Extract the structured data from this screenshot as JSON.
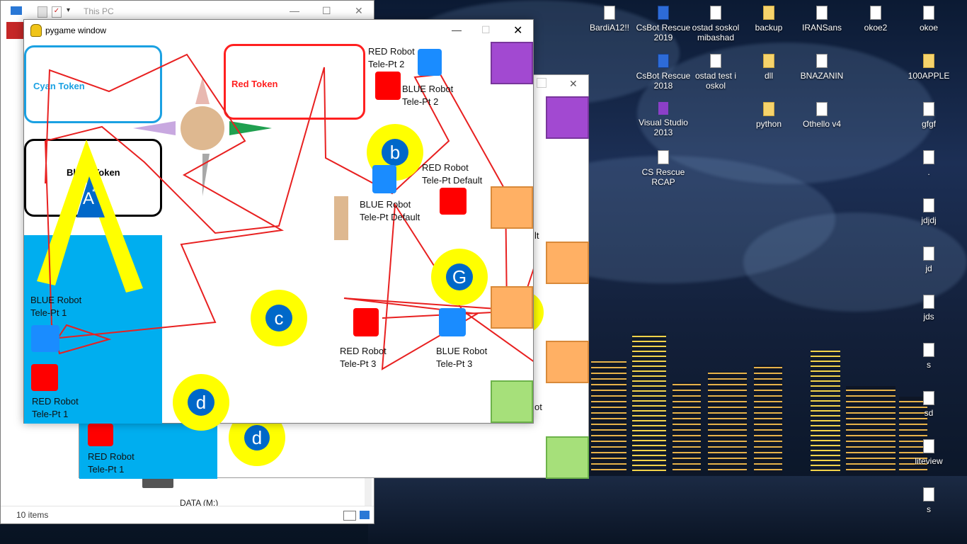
{
  "desktop": {
    "icons": [
      {
        "label": "BardiA12!!",
        "icon": "file-icon"
      },
      {
        "label": "CsBot Rescue 2019",
        "icon": "app-icon"
      },
      {
        "label": "ostad soskol mibashad",
        "icon": "file-icon"
      },
      {
        "label": "backup",
        "icon": "folder-icon"
      },
      {
        "label": "IRANSans",
        "icon": "font-file-icon"
      },
      {
        "label": "okoe2",
        "icon": "file-icon"
      },
      {
        "label": "okoe",
        "icon": "file-icon"
      },
      {
        "label": "CsBot Rescue 2018",
        "icon": "app-icon"
      },
      {
        "label": "ostad test i oskol",
        "icon": "file-icon"
      },
      {
        "label": "dll",
        "icon": "folder-icon"
      },
      {
        "label": "BNAZANIN",
        "icon": "font-file-icon"
      },
      {
        "label": "100APPLE",
        "icon": "folder-icon"
      },
      {
        "label": "Visual Studio 2013",
        "icon": "visual-studio-icon"
      },
      {
        "label": "python",
        "icon": "folder-icon"
      },
      {
        "label": "Othello v4",
        "icon": "file-icon"
      },
      {
        "label": "gfgf",
        "icon": "file-icon"
      },
      {
        "label": "CS Rescue RCAP",
        "icon": "file-icon"
      },
      {
        "label": ".",
        "icon": "file-icon"
      },
      {
        "label": "jdjdj",
        "icon": "file-icon"
      },
      {
        "label": "jd",
        "icon": "file-icon"
      },
      {
        "label": "jds",
        "icon": "file-icon"
      },
      {
        "label": "s",
        "icon": "file-icon"
      },
      {
        "label": "sd",
        "icon": "file-icon"
      },
      {
        "label": "liteview",
        "icon": "file-icon"
      },
      {
        "label": "s",
        "icon": "file-icon"
      }
    ]
  },
  "explorer": {
    "title": "This PC",
    "status": "10 items",
    "drive": "DATA (M:)",
    "min": "—",
    "max": "☐",
    "close": "✕"
  },
  "pygame": {
    "title": "pygame window",
    "min": "—",
    "max": "☐",
    "close": "✕",
    "tokens": {
      "cyan": "Cyan Token",
      "red": "Red Token",
      "black": "Black Token"
    },
    "a_star": "A",
    "a_star_mark": "*",
    "circles": {
      "b": "b",
      "c": "c",
      "g": "G",
      "d": "d"
    },
    "labels": {
      "red_tp2_l1": "RED Robot",
      "red_tp2_l2": "Tele-Pt 2",
      "blue_tp2_l1": "BLUE Robot",
      "blue_tp2_l2": "Tele-Pt 2",
      "red_tpd_l1": "RED Robot",
      "red_tpd_l2": "Tele-Pt Default",
      "blue_tpd_l1": "BLUE Robot",
      "blue_tpd_l2": "Tele-Pt Default",
      "blue_tp1_l1": "BLUE Robot",
      "blue_tp1_l2": "Tele-Pt 1",
      "red_tp1_l1": "RED Robot",
      "red_tp1_l2": "Tele-Pt 1",
      "red_tp3_l1": "RED Robot",
      "red_tp3_l2": "Tele-Pt 3",
      "blue_tp3_l1": "BLUE Robot",
      "blue_tp3_l2": "Tele-Pt 3"
    }
  },
  "pygame_back": {
    "close": "✕",
    "circle_d": "d",
    "red_tp1_l1": "RED Robot",
    "red_tp1_l2": "Tele-Pt 1",
    "partial_lt": "lt",
    "partial_ot": "ot"
  },
  "colors": {
    "cyan": "#1ba1e2",
    "red_token": "#ff2020",
    "yellow": "#ffff00",
    "blue_circle": "#0068c9",
    "path": "#e82020"
  }
}
